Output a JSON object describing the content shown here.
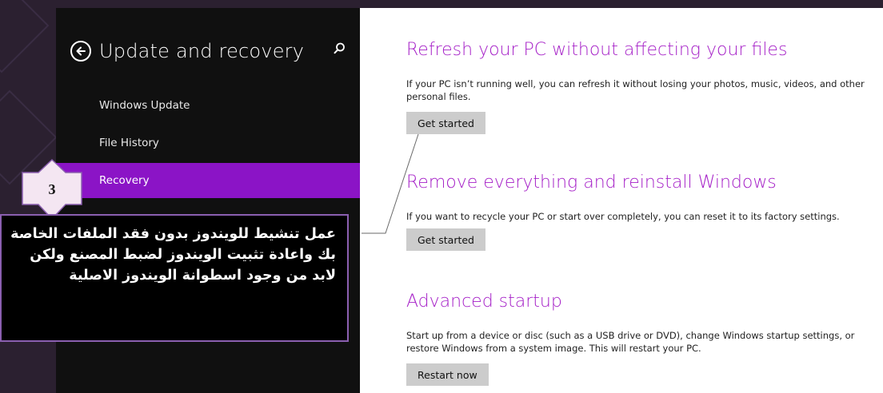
{
  "header": {
    "title": "Update and recovery"
  },
  "nav": {
    "items": [
      {
        "label": "Windows Update",
        "selected": false
      },
      {
        "label": "File History",
        "selected": false
      },
      {
        "label": "Recovery",
        "selected": true
      }
    ]
  },
  "sections": [
    {
      "title": "Refresh your PC without affecting your files",
      "description": "If your PC isn’t running well, you can refresh it without losing your photos, music, videos, and other personal files.",
      "button": "Get started"
    },
    {
      "title": "Remove everything and reinstall Windows",
      "description": "If you want to recycle your PC or start over completely, you can reset it to its factory settings.",
      "button": "Get started"
    },
    {
      "title": "Advanced startup",
      "description": "Start up from a device or disc (such as a USB drive or DVD), change Windows startup settings, or restore Windows from a system image. This will restart your PC.",
      "button": "Restart now"
    }
  ],
  "annotation": {
    "step": "3",
    "text": "عمل تنشيط للويندوز بدون فقد الملفات الخاصة بك واعادة تثبيت الويندوز لضبط المصنع ولكن لابد من وجود اسطوانة الويندوز الاصلية"
  },
  "colors": {
    "accent": "#8b14c6",
    "title": "#a51fc7",
    "pane": "#101010",
    "button": "#cccccc"
  },
  "icons": [
    "back-arrow-icon",
    "search-icon"
  ]
}
